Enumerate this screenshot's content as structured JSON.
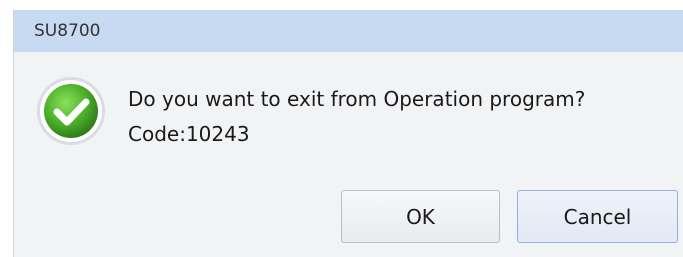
{
  "window": {
    "title": "SU8700"
  },
  "message": {
    "icon": "check-circle-icon",
    "line1": "Do you want to exit from Operation program?",
    "line2": "Code:10243"
  },
  "buttons": {
    "ok_label": "OK",
    "cancel_label": "Cancel"
  },
  "colors": {
    "titlebar": "#c7daf2",
    "dialog_bg": "#f2f3f5",
    "icon_green": "#4caf2a"
  }
}
